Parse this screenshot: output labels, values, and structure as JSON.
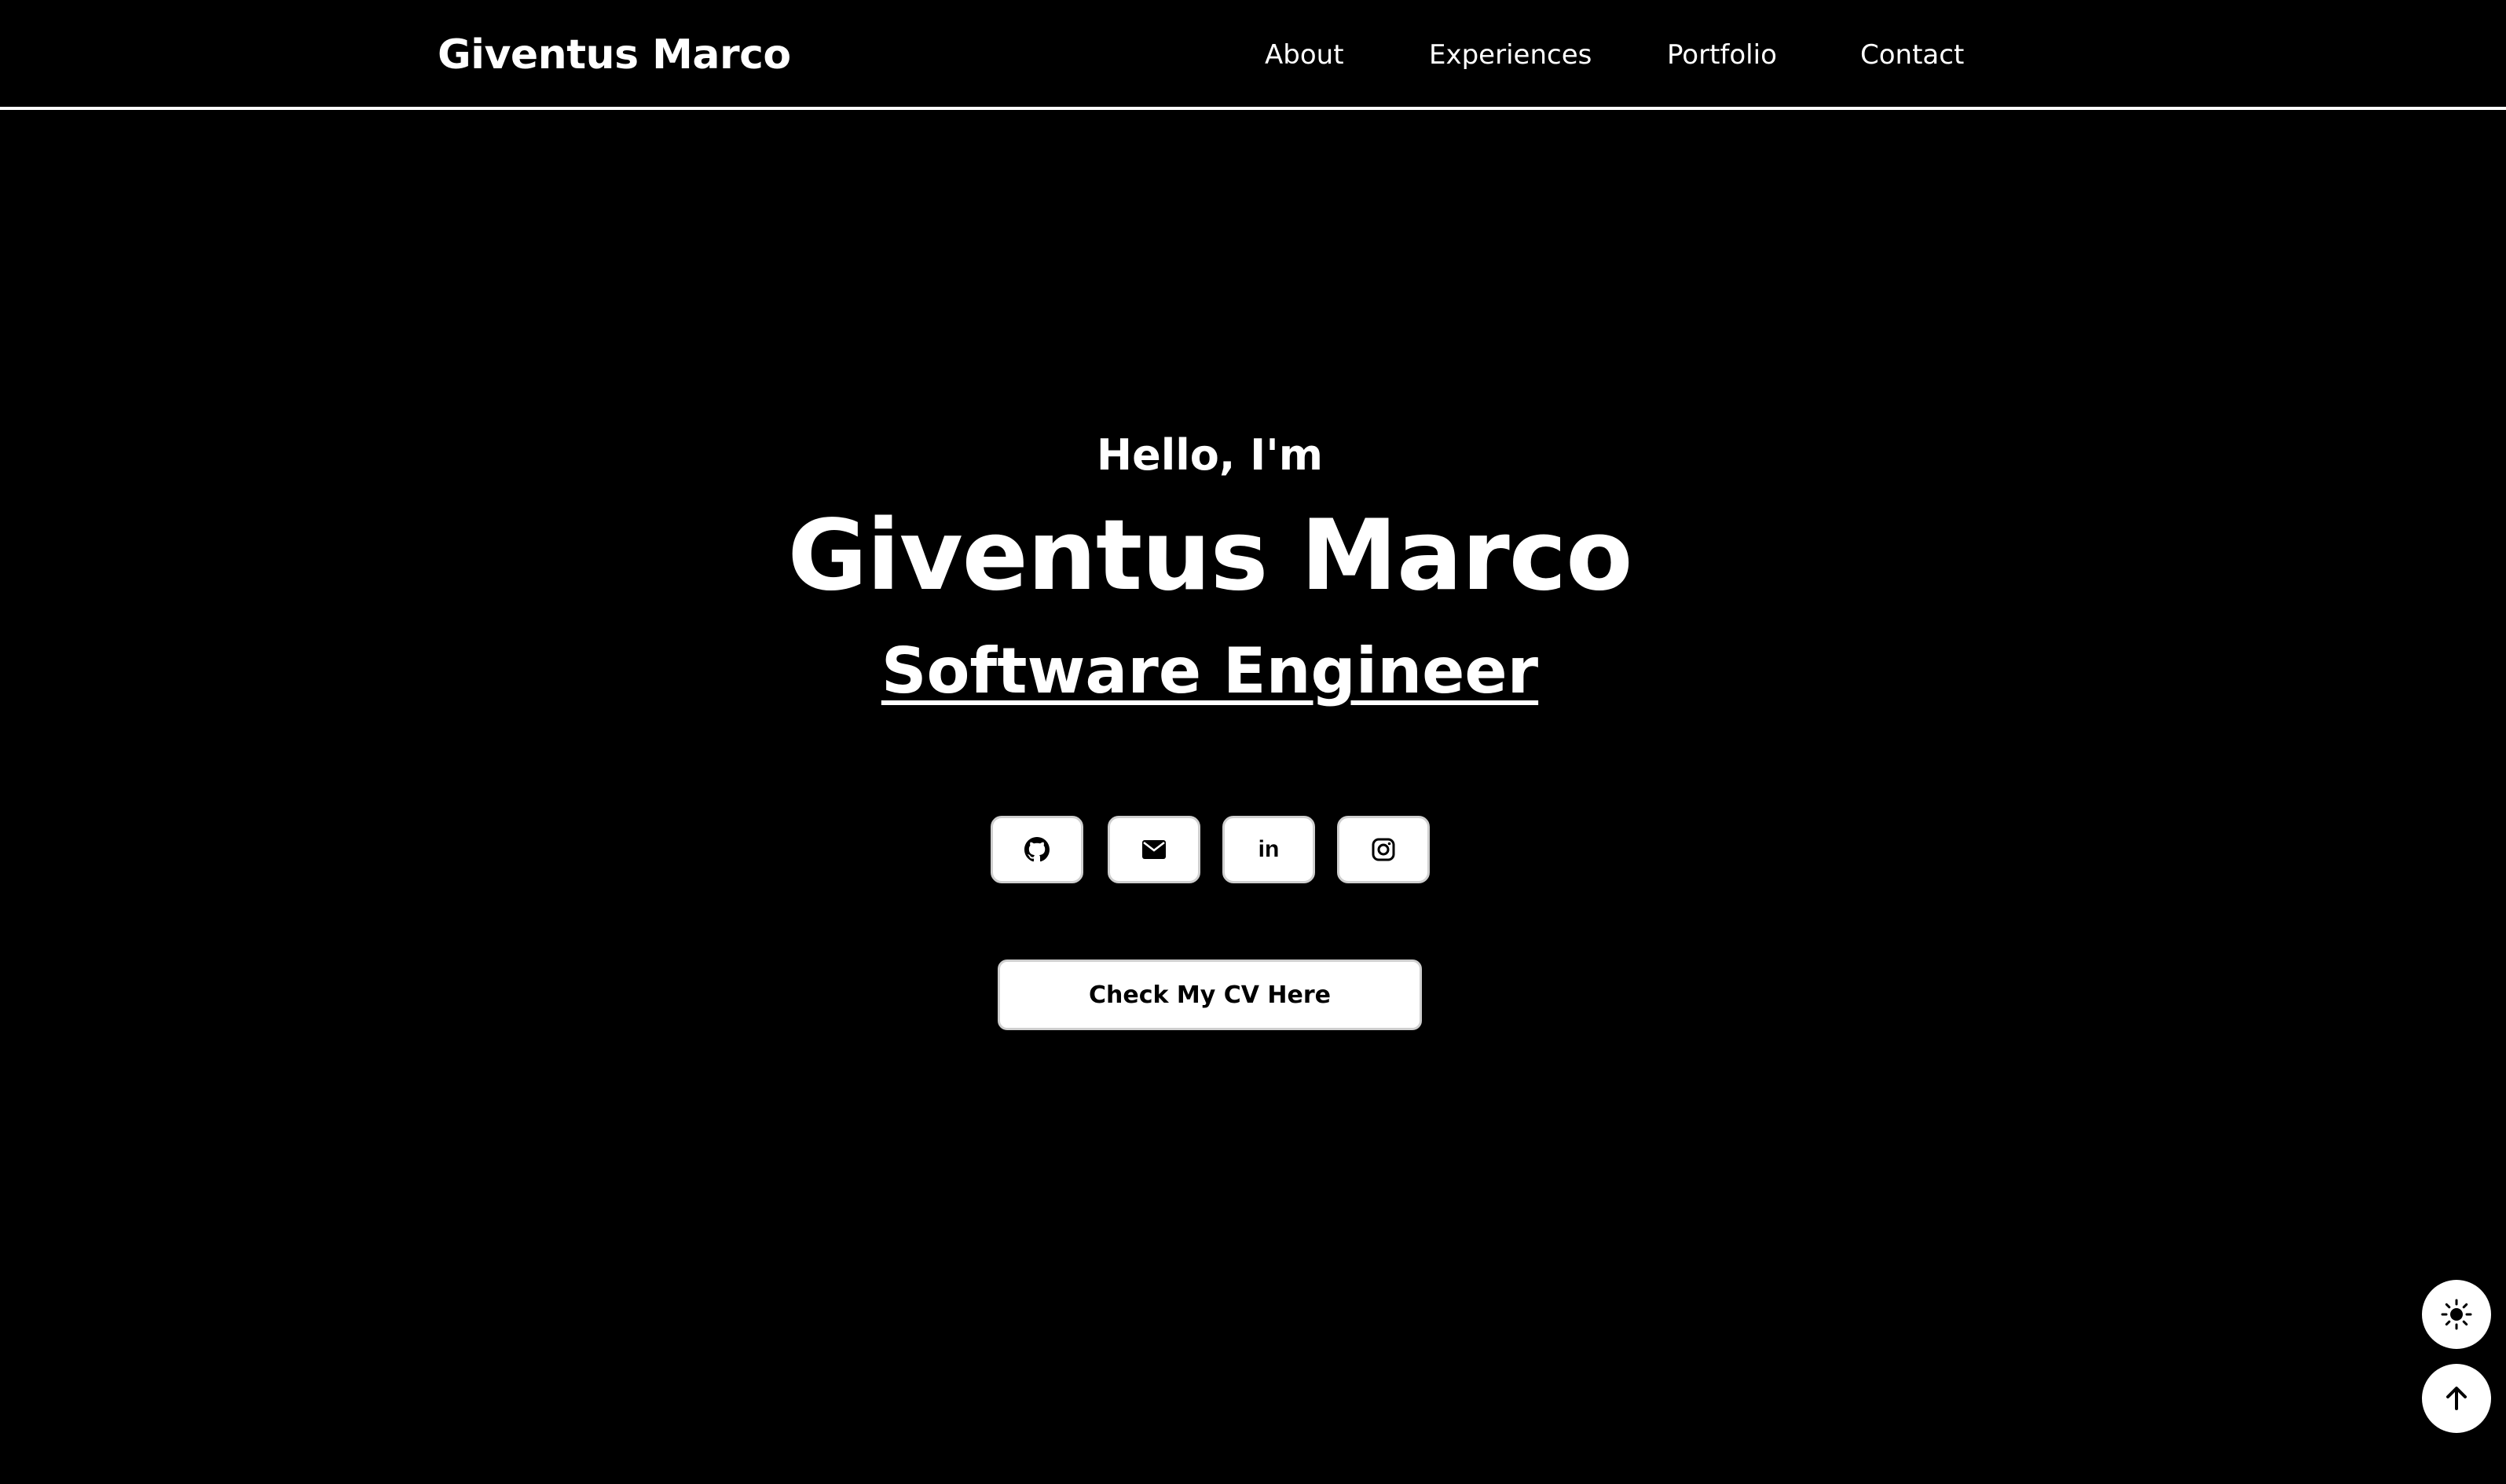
{
  "header": {
    "brand": "Giventus Marco",
    "nav": [
      "About",
      "Experiences",
      "Portfolio",
      "Contact"
    ]
  },
  "hero": {
    "greeting": "Hello, I'm",
    "name": "Giventus Marco",
    "role": "Software Engineer"
  },
  "social": [
    {
      "icon": "github-icon"
    },
    {
      "icon": "mail-icon"
    },
    {
      "icon": "linkedin-icon",
      "text": "in"
    },
    {
      "icon": "instagram-icon"
    }
  ],
  "cv_button": {
    "label": "Check My CV Here"
  },
  "floating": {
    "theme_icon": "sun-icon",
    "top_icon": "arrow-up-icon"
  },
  "colors": {
    "background": "#000000",
    "foreground": "#ffffff",
    "button_border": "#cfcfcf"
  }
}
